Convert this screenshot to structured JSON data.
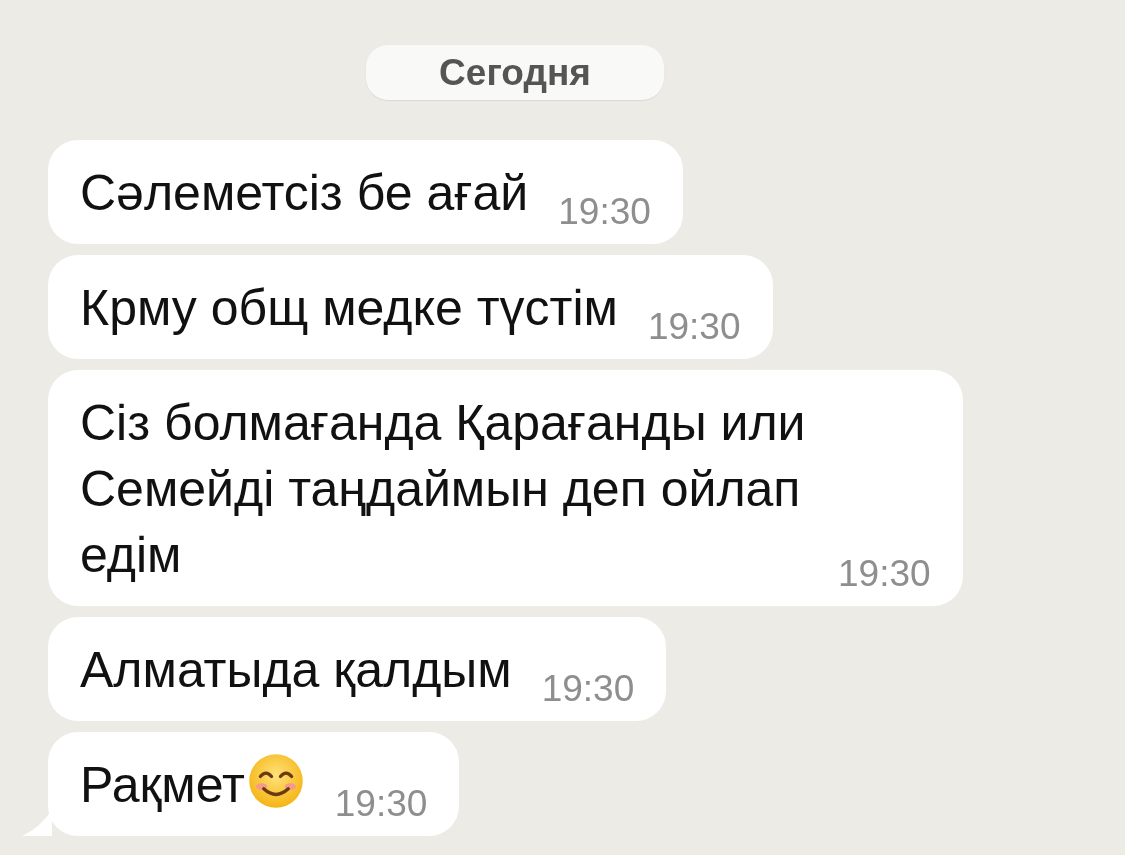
{
  "date_divider": "Сегодня",
  "messages": [
    {
      "text": "Сәлеметсіз бе ағай",
      "time": "19:30",
      "emoji": false,
      "tail": false
    },
    {
      "text": "Крму общ медке түстім",
      "time": "19:30",
      "emoji": false,
      "tail": false
    },
    {
      "text": "Сіз болмағанда Қарағанды или Семейді таңдаймын деп ойлап едім",
      "time": "19:30",
      "emoji": false,
      "tail": false
    },
    {
      "text": "Алматыда қалдым",
      "time": "19:30",
      "emoji": false,
      "tail": false
    },
    {
      "text": "Рақмет",
      "time": "19:30",
      "emoji": true,
      "tail": true
    }
  ]
}
